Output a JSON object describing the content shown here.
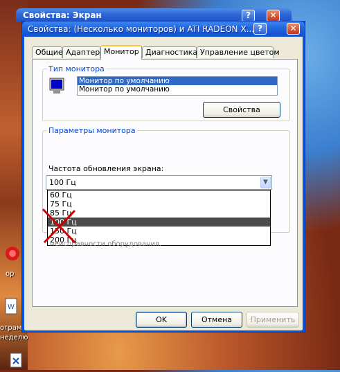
{
  "back_window": {
    "title": "Свойства: Экран"
  },
  "window": {
    "title": "Свойства: (Несколько мониторов) и ATI RADEON X...",
    "help_glyph": "?",
    "close_glyph": "✕"
  },
  "tabs": [
    {
      "label": "Общие"
    },
    {
      "label": "Адаптер"
    },
    {
      "label": "Монитор"
    },
    {
      "label": "Диагностика"
    },
    {
      "label": "Управление цветом"
    }
  ],
  "monitor_type": {
    "legend": "Тип монитора",
    "items": [
      "Монитор по умолчанию",
      "Монитор по умолчанию"
    ],
    "properties_button": "Свойства"
  },
  "monitor_params": {
    "legend": "Параметры монитора",
    "refresh_label": "Частота обновления экрана:",
    "refresh_value": "100 Гц",
    "options": [
      "60 Гц",
      "75 Гц",
      "85 Гц",
      "100 Гц",
      "150 Гц",
      "200 Гц"
    ],
    "hardware_note": "неисправности оборудования."
  },
  "buttons": {
    "ok": "OK",
    "cancel": "Отмена",
    "apply": "Применить"
  },
  "desktop": {
    "labels": [
      "ор",
      "ограмм",
      "неделю"
    ]
  },
  "colors": {
    "title_blue": "#0055e5",
    "legend_blue": "#0046d5",
    "highlight": "#4b4b4b",
    "cross_red": "#cc0000"
  }
}
